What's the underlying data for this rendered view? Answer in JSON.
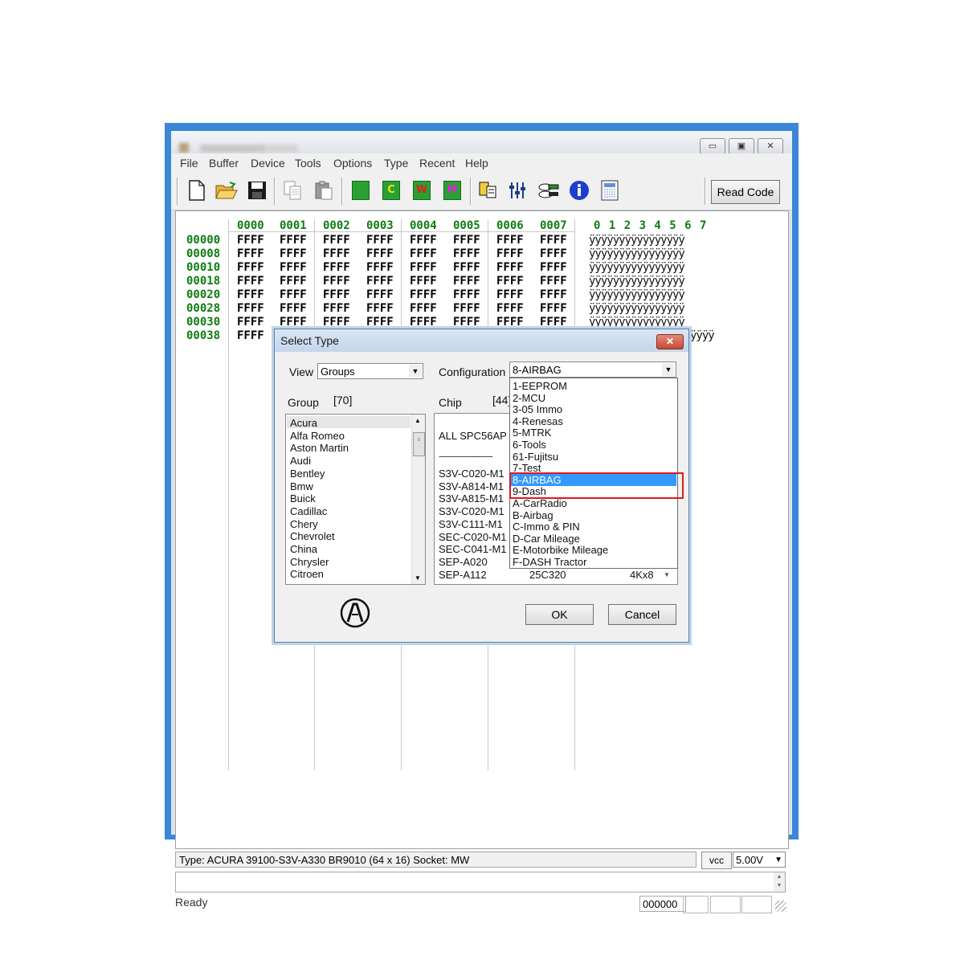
{
  "menu": [
    "File",
    "Buffer",
    "Device",
    "Tools",
    "Options",
    "Type",
    "Recent",
    "Help"
  ],
  "toolbar": {
    "chip_labels": [
      "",
      "C",
      "W",
      "M"
    ],
    "read_code_label": "Read Code"
  },
  "hex": {
    "column_headers": [
      "0000",
      "0001",
      "0002",
      "0003",
      "0004",
      "0005",
      "0006",
      "0007"
    ],
    "ascii_header": "0 1 2 3 4 5 6 7",
    "row_addresses": [
      "00000",
      "00008",
      "00010",
      "00018",
      "00020",
      "00028",
      "00030",
      "00038"
    ],
    "cell_value": "FFFF",
    "ascii_row": "ÿÿÿÿÿÿÿÿÿÿÿÿÿÿÿÿ",
    "last_row_ascii_visible": "ÿÿÿÿ"
  },
  "type_bar": {
    "text": "Type: ACURA 39100-S3V-A330 BR9010 (64 x 16)   Socket: MW",
    "vcc_label": "vcc",
    "voltage": "5.00V"
  },
  "status": {
    "text": "Ready",
    "counter": "000000"
  },
  "dialog": {
    "title": "Select Type",
    "close_label": "✕",
    "view_label": "View",
    "view_value": "Groups",
    "configuration_label": "Configuration",
    "configuration_value": "8-AIRBAG",
    "group_label": "Group",
    "group_count": "[70]",
    "chip_label": "Chip",
    "chip_count": "[44]",
    "groups": [
      "Acura",
      "Alfa Romeo",
      "Aston Martin",
      "Audi",
      "Bentley",
      "Bmw",
      "Buick",
      "Cadillac",
      "Chery",
      "Chevrolet",
      "China",
      "Chrysler",
      "Citroen"
    ],
    "chips_header": "ALL  SPC56AP",
    "chips_divider": "--------------------",
    "chips": [
      "S3V-C020-M1",
      "S3V-A814-M1",
      "S3V-A815-M1",
      "S3V-C020-M1",
      "S3V-C111-M1",
      "SEC-C020-M1",
      "SEC-C041-M1",
      "SEP-A020",
      "SEP-A112"
    ],
    "last_chip_part": "25C320",
    "last_chip_size": "4Kx8",
    "ok_label": "OK",
    "cancel_label": "Cancel"
  },
  "configuration_options": [
    "1-EEPROM",
    "2-MCU",
    "3-05 Immo",
    "4-Renesas",
    "5-MTRK",
    "6-Tools",
    "61-Fujitsu",
    "7-Test",
    "8-AIRBAG",
    "9-Dash",
    "A-CarRadio",
    "B-Airbag",
    "C-Immo & PIN",
    "D-Car Mileage",
    "E-Motorbike Mileage",
    "F-DASH Tractor"
  ],
  "selected_option_index": 8,
  "colors": {
    "hex_address": "#0e7d11",
    "selection": "#3399ff",
    "highlight_box": "#e01818",
    "window_frame": "#3a87d8"
  }
}
